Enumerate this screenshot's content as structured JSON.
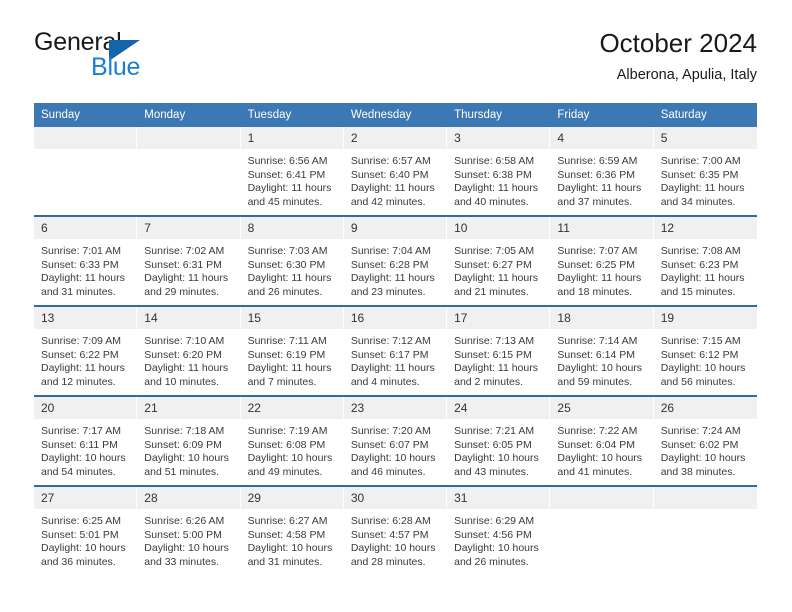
{
  "brand": {
    "word_one": "General",
    "word_two": "Blue",
    "triangle_color": "#1464aa",
    "blue_text_color": "#1a7fd4"
  },
  "header": {
    "title": "October 2024",
    "subtitle": "Alberona, Apulia, Italy"
  },
  "theme": {
    "header_blue": "#3c78b4",
    "rule_blue": "#2e6da4",
    "daynum_band": "#f0f0f0"
  },
  "calendar": {
    "weekday_headers": [
      "Sunday",
      "Monday",
      "Tuesday",
      "Wednesday",
      "Thursday",
      "Friday",
      "Saturday"
    ],
    "weeks": [
      [
        {
          "day": "",
          "lines": []
        },
        {
          "day": "",
          "lines": []
        },
        {
          "day": "1",
          "lines": [
            "Sunrise: 6:56 AM",
            "Sunset: 6:41 PM",
            "Daylight: 11 hours and 45 minutes."
          ]
        },
        {
          "day": "2",
          "lines": [
            "Sunrise: 6:57 AM",
            "Sunset: 6:40 PM",
            "Daylight: 11 hours and 42 minutes."
          ]
        },
        {
          "day": "3",
          "lines": [
            "Sunrise: 6:58 AM",
            "Sunset: 6:38 PM",
            "Daylight: 11 hours and 40 minutes."
          ]
        },
        {
          "day": "4",
          "lines": [
            "Sunrise: 6:59 AM",
            "Sunset: 6:36 PM",
            "Daylight: 11 hours and 37 minutes."
          ]
        },
        {
          "day": "5",
          "lines": [
            "Sunrise: 7:00 AM",
            "Sunset: 6:35 PM",
            "Daylight: 11 hours and 34 minutes."
          ]
        }
      ],
      [
        {
          "day": "6",
          "lines": [
            "Sunrise: 7:01 AM",
            "Sunset: 6:33 PM",
            "Daylight: 11 hours and 31 minutes."
          ]
        },
        {
          "day": "7",
          "lines": [
            "Sunrise: 7:02 AM",
            "Sunset: 6:31 PM",
            "Daylight: 11 hours and 29 minutes."
          ]
        },
        {
          "day": "8",
          "lines": [
            "Sunrise: 7:03 AM",
            "Sunset: 6:30 PM",
            "Daylight: 11 hours and 26 minutes."
          ]
        },
        {
          "day": "9",
          "lines": [
            "Sunrise: 7:04 AM",
            "Sunset: 6:28 PM",
            "Daylight: 11 hours and 23 minutes."
          ]
        },
        {
          "day": "10",
          "lines": [
            "Sunrise: 7:05 AM",
            "Sunset: 6:27 PM",
            "Daylight: 11 hours and 21 minutes."
          ]
        },
        {
          "day": "11",
          "lines": [
            "Sunrise: 7:07 AM",
            "Sunset: 6:25 PM",
            "Daylight: 11 hours and 18 minutes."
          ]
        },
        {
          "day": "12",
          "lines": [
            "Sunrise: 7:08 AM",
            "Sunset: 6:23 PM",
            "Daylight: 11 hours and 15 minutes."
          ]
        }
      ],
      [
        {
          "day": "13",
          "lines": [
            "Sunrise: 7:09 AM",
            "Sunset: 6:22 PM",
            "Daylight: 11 hours and 12 minutes."
          ]
        },
        {
          "day": "14",
          "lines": [
            "Sunrise: 7:10 AM",
            "Sunset: 6:20 PM",
            "Daylight: 11 hours and 10 minutes."
          ]
        },
        {
          "day": "15",
          "lines": [
            "Sunrise: 7:11 AM",
            "Sunset: 6:19 PM",
            "Daylight: 11 hours and 7 minutes."
          ]
        },
        {
          "day": "16",
          "lines": [
            "Sunrise: 7:12 AM",
            "Sunset: 6:17 PM",
            "Daylight: 11 hours and 4 minutes."
          ]
        },
        {
          "day": "17",
          "lines": [
            "Sunrise: 7:13 AM",
            "Sunset: 6:15 PM",
            "Daylight: 11 hours and 2 minutes."
          ]
        },
        {
          "day": "18",
          "lines": [
            "Sunrise: 7:14 AM",
            "Sunset: 6:14 PM",
            "Daylight: 10 hours and 59 minutes."
          ]
        },
        {
          "day": "19",
          "lines": [
            "Sunrise: 7:15 AM",
            "Sunset: 6:12 PM",
            "Daylight: 10 hours and 56 minutes."
          ]
        }
      ],
      [
        {
          "day": "20",
          "lines": [
            "Sunrise: 7:17 AM",
            "Sunset: 6:11 PM",
            "Daylight: 10 hours and 54 minutes."
          ]
        },
        {
          "day": "21",
          "lines": [
            "Sunrise: 7:18 AM",
            "Sunset: 6:09 PM",
            "Daylight: 10 hours and 51 minutes."
          ]
        },
        {
          "day": "22",
          "lines": [
            "Sunrise: 7:19 AM",
            "Sunset: 6:08 PM",
            "Daylight: 10 hours and 49 minutes."
          ]
        },
        {
          "day": "23",
          "lines": [
            "Sunrise: 7:20 AM",
            "Sunset: 6:07 PM",
            "Daylight: 10 hours and 46 minutes."
          ]
        },
        {
          "day": "24",
          "lines": [
            "Sunrise: 7:21 AM",
            "Sunset: 6:05 PM",
            "Daylight: 10 hours and 43 minutes."
          ]
        },
        {
          "day": "25",
          "lines": [
            "Sunrise: 7:22 AM",
            "Sunset: 6:04 PM",
            "Daylight: 10 hours and 41 minutes."
          ]
        },
        {
          "day": "26",
          "lines": [
            "Sunrise: 7:24 AM",
            "Sunset: 6:02 PM",
            "Daylight: 10 hours and 38 minutes."
          ]
        }
      ],
      [
        {
          "day": "27",
          "lines": [
            "Sunrise: 6:25 AM",
            "Sunset: 5:01 PM",
            "Daylight: 10 hours and 36 minutes."
          ]
        },
        {
          "day": "28",
          "lines": [
            "Sunrise: 6:26 AM",
            "Sunset: 5:00 PM",
            "Daylight: 10 hours and 33 minutes."
          ]
        },
        {
          "day": "29",
          "lines": [
            "Sunrise: 6:27 AM",
            "Sunset: 4:58 PM",
            "Daylight: 10 hours and 31 minutes."
          ]
        },
        {
          "day": "30",
          "lines": [
            "Sunrise: 6:28 AM",
            "Sunset: 4:57 PM",
            "Daylight: 10 hours and 28 minutes."
          ]
        },
        {
          "day": "31",
          "lines": [
            "Sunrise: 6:29 AM",
            "Sunset: 4:56 PM",
            "Daylight: 10 hours and 26 minutes."
          ]
        },
        {
          "day": "",
          "lines": []
        },
        {
          "day": "",
          "lines": []
        }
      ]
    ]
  }
}
